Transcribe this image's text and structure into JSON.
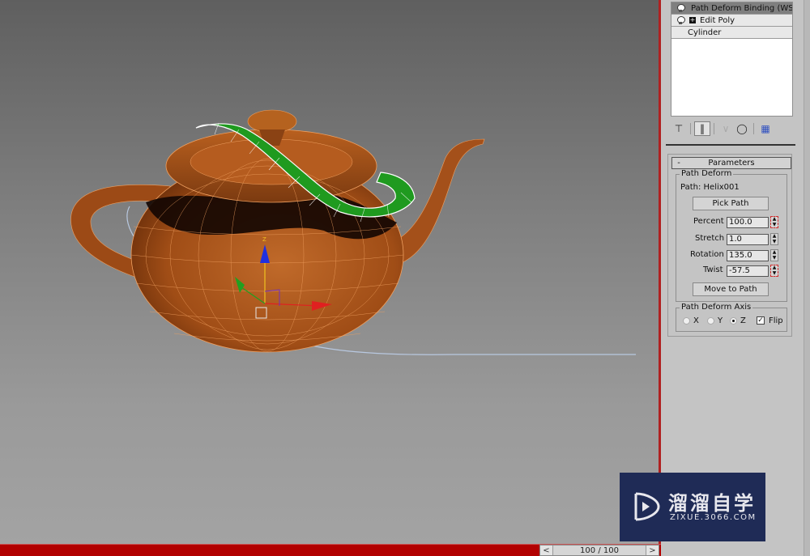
{
  "viewport": {
    "objects": [
      "teapot",
      "cylinder-deformed",
      "helix-path"
    ],
    "gizmo_axes": {
      "x": "X",
      "y": "Y",
      "z": "Z"
    },
    "colors": {
      "teapot": "#b35a1e",
      "wire": "#f0a060",
      "cylinder": "#1e9a1e",
      "path": "#b8c8e0",
      "axis_x": "#e02020",
      "axis_y": "#20a020",
      "axis_z": "#2030e0"
    }
  },
  "timeline": {
    "prev_icon": "<",
    "next_icon": ">",
    "frame_label": "100 / 100"
  },
  "modifier_stack": {
    "items": [
      {
        "label": "Path Deform Binding (WS",
        "icon": "lightbulb-icon",
        "selected": true
      },
      {
        "label": "Edit Poly",
        "icon": "lightbulb-icon",
        "expand": "+"
      },
      {
        "label": "Cylinder"
      }
    ]
  },
  "stack_toolbar": {
    "pin_icon": "pin-stack-icon",
    "show_end_icon": "show-end-result-icon",
    "unique_icon": "make-unique-icon",
    "remove_icon": "remove-modifier-icon",
    "configure_icon": "configure-modifier-sets-icon"
  },
  "parameters": {
    "rollout_title": "Parameters",
    "collapse_symbol": "-",
    "path_deform_group": "Path Deform",
    "path_label": "Path: Helix001",
    "pick_path": "Pick Path",
    "fields": [
      {
        "label": "Percent",
        "value": "100.0",
        "keyed": true
      },
      {
        "label": "Stretch",
        "value": "1.0",
        "keyed": false
      },
      {
        "label": "Rotation",
        "value": "135.0",
        "keyed": false
      },
      {
        "label": "Twist",
        "value": "-57.5",
        "keyed": true
      }
    ],
    "move_to_path": "Move to Path",
    "axis_group": "Path Deform Axis",
    "axis_options": [
      "X",
      "Y",
      "Z"
    ],
    "axis_selected": "Z",
    "flip_label": "Flip",
    "flip_checked": true
  },
  "watermark": {
    "brand": "溜溜自学",
    "url": "ZIXUE.3066.COM"
  }
}
